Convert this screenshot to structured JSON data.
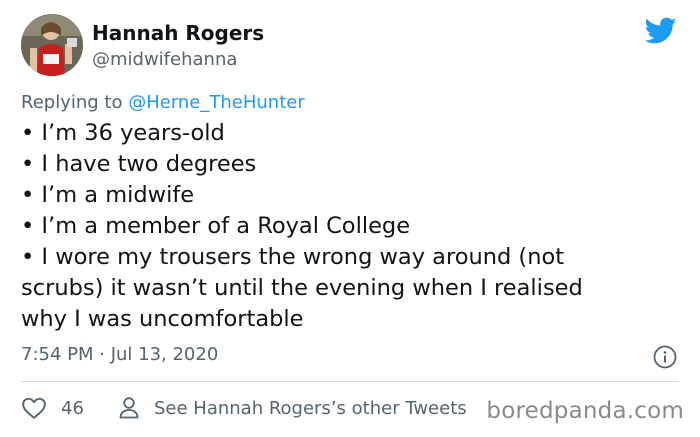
{
  "tweet": {
    "author_name": "Hannah Rogers",
    "author_handle": "@midwifehanna",
    "replying_prefix": "Replying to ",
    "replying_to": "@Herne_TheHunter",
    "lines": [
      "• I’m 36 years-old",
      "• I have two degrees",
      "• I’m a midwife",
      "• I’m a member of a Royal College",
      "• I wore my trousers the wrong way around (not",
      "scrubs) it wasn’t until the evening when I realised",
      "why I was uncomfortable"
    ],
    "timestamp": "7:54 PM · Jul 13, 2020",
    "likes": "46",
    "see_other": "See Hannah Rogers’s other Tweets"
  },
  "watermark": "boredpanda.com",
  "icons": {
    "brand": "twitter-bird-icon",
    "info": "info-icon",
    "like": "heart-icon",
    "profile": "person-icon"
  },
  "colors": {
    "twitter_blue": "#1d9bf0",
    "secondary_text": "#536471",
    "primary_text": "#0f1419",
    "divider": "#cfd9de"
  }
}
